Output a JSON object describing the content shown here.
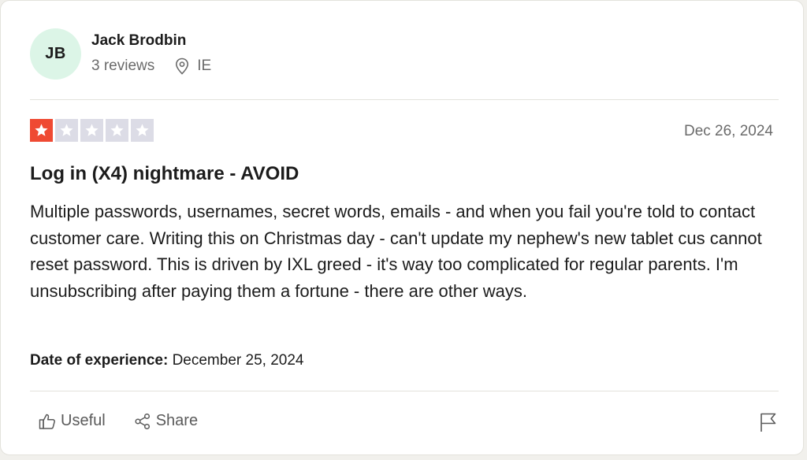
{
  "reviewer": {
    "initials": "JB",
    "name": "Jack Brodbin",
    "reviews_count": "3 reviews",
    "country": "IE",
    "avatar_color": "#dcf5e7"
  },
  "review": {
    "rating": 1,
    "rating_max": 5,
    "star_filled_color": "#ef4a33",
    "star_empty_color": "#dcdce6",
    "date": "Dec 26, 2024",
    "title": "Log in (X4) nightmare - AVOID",
    "body": "Multiple passwords, usernames, secret words, emails - and when you fail you're told to contact customer care. Writing this on Christmas day - can't update my nephew's new tablet cus cannot reset password. This is driven by IXL greed - it's way too complicated for regular parents. I'm unsubscribing after paying them a fortune - there are other ways.",
    "experience_label": "Date of experience:",
    "experience_date": "December 25, 2024"
  },
  "actions": {
    "useful_label": "Useful",
    "share_label": "Share",
    "icons": [
      "thumbs-up-icon",
      "share-icon",
      "flag-icon",
      "location-pin-icon",
      "star-icon"
    ]
  }
}
